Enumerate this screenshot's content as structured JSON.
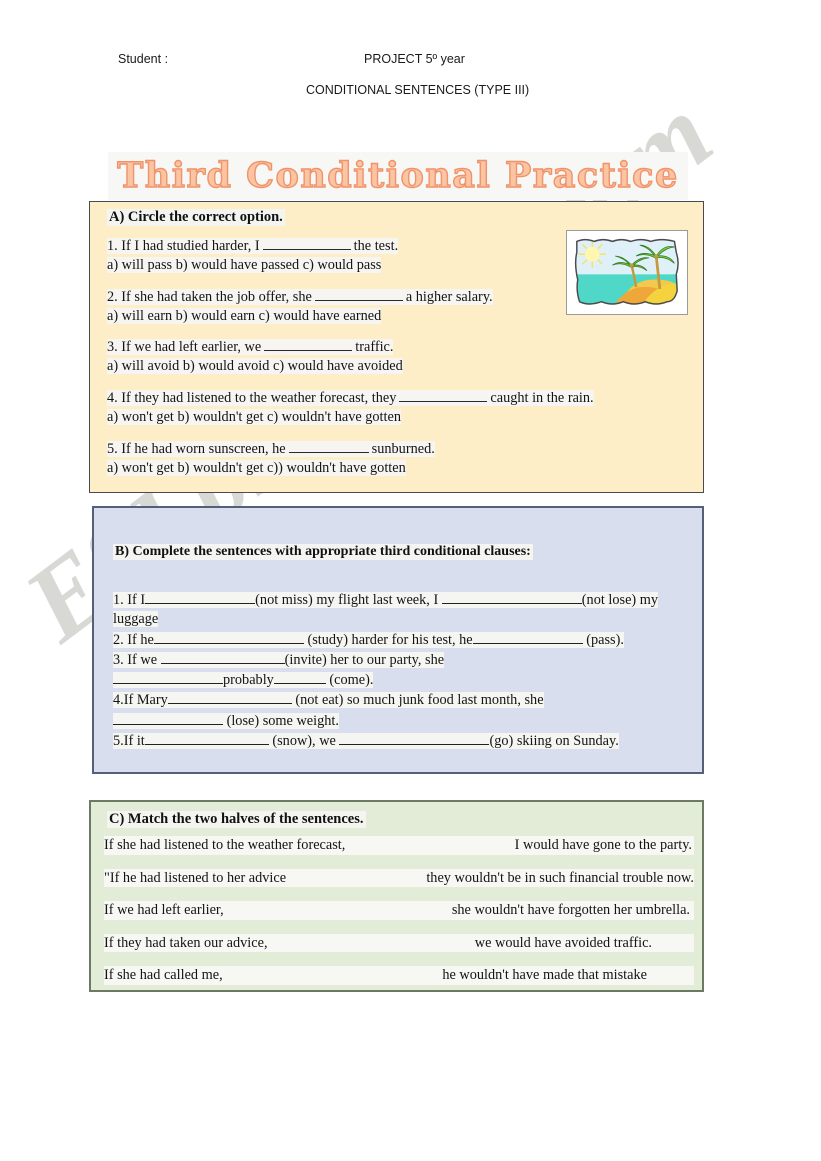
{
  "header": {
    "student_label": "Student :",
    "project": "PROJECT 5º year",
    "subtitle": "CONDITIONAL SENTENCES (TYPE III)"
  },
  "title": "Third Conditional Practice",
  "watermark": "ESLprintables.com",
  "colors": {
    "section_a_bg": "#fdeec7",
    "section_b_bg": "#d9deef",
    "section_c_bg": "#e2ecd6",
    "title_fill": "#fbc4a2",
    "title_outline": "#f0936a",
    "border_a": "#4a4a55",
    "border_b": "#565f79",
    "border_c": "#6d7a63"
  },
  "section_a": {
    "heading": "A)  Circle the correct option.",
    "clipart_alt": "tropical beach with palm trees",
    "questions": [
      {
        "stem_before": "1. If I had studied harder, I",
        "stem_after": "the test.",
        "blank": "b-lg",
        "options": "a) will pass     b) would have passed   c) would pass"
      },
      {
        "stem_before": "2. If she had taken the job offer, she",
        "stem_after": "a higher salary.",
        "blank": "b-lg",
        "options": "a) will earn      b) would earn        c) would have earned"
      },
      {
        "stem_before": "3. If we had left earlier, we",
        "stem_after": "traffic.",
        "blank": "b-lg",
        "options": "a) will avoid  b) would avoid    c) would have avoided"
      },
      {
        "stem_before": "4. If they had listened to the weather forecast, they",
        "stem_after": "caught in the rain.",
        "blank": "b-lg",
        "options": "a) won't get     b) wouldn't get   c) wouldn't have gotten"
      },
      {
        "stem_before": "5. If he had worn sunscreen, he",
        "stem_after": "sunburned.",
        "blank": "b-md",
        "options": "a) won't get   b) wouldn't get    c)) wouldn't have gotten"
      }
    ]
  },
  "section_b": {
    "heading": "B) Complete the sentences with appropriate third conditional clauses:",
    "lines": [
      {
        "id": "b1a",
        "parts": [
          "1. If I",
          "BLANK:u2",
          "(not miss) my flight last week, I ",
          "BLANK:u3",
          "(not lose) my"
        ]
      },
      {
        "id": "b1b",
        "parts": [
          "luggage"
        ]
      },
      {
        "id": "b2",
        "parts": [
          "2. If he",
          "BLANK:u8",
          " (study) harder for his test, he",
          "BLANK:u2",
          " (pass)."
        ]
      },
      {
        "id": "b3a",
        "parts": [
          "3. If we ",
          "BLANK:u6",
          "(invite) her to our party, she"
        ]
      },
      {
        "id": "b3b",
        "parts": [
          "BLANK:u2",
          "probably",
          "BLANK:u7",
          " (come)."
        ]
      },
      {
        "id": "b4a",
        "parts": [
          "4.If Mary",
          "BLANK:u6",
          " (not eat) so much junk food last month, she"
        ]
      },
      {
        "id": "b4b",
        "parts": [
          "BLANK:u2",
          " (lose) some weight."
        ]
      },
      {
        "id": "b5",
        "parts": [
          "5.If it",
          "BLANK:u6",
          " (snow), we ",
          "BLANK:u8",
          "(go) skiing on Sunday."
        ]
      }
    ]
  },
  "section_c": {
    "heading": "C)  Match the two halves of the sentences.",
    "rows": [
      {
        "left": "If she had listened to the weather forecast,",
        "right": "I would have gone to the party."
      },
      {
        "left": "\"If he had listened to her advice",
        "right": "they wouldn't be in such financial trouble now."
      },
      {
        "left": "If we had left earlier,",
        "right": "she wouldn't have forgotten her umbrella."
      },
      {
        "left": "If they had taken our advice,",
        "right": "we would have avoided traffic."
      },
      {
        "left": "If she had called me,",
        "right": "he wouldn't have made that mistake"
      }
    ]
  }
}
